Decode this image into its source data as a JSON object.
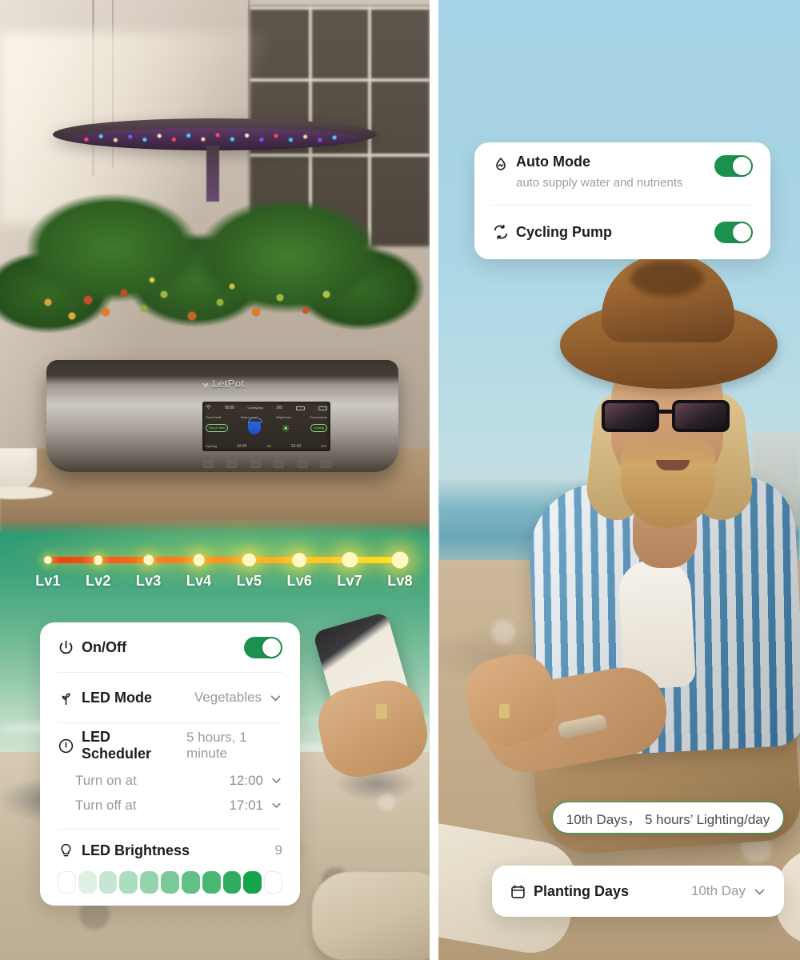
{
  "brand": {
    "name": "LetPot",
    "logo_icon": "leaf-icon"
  },
  "device_display": {
    "wifi_icon": "wifi-icon",
    "time": "00:00",
    "growby_label": "GrowbyDays",
    "growby_value": "8/5",
    "plant_mode_label": "Plant Mode",
    "plant_mode_value": "Veg & Herb",
    "water_level_label": "Water Level",
    "brightness_label": "Brightness",
    "pump_mode_label": "Pump Mode",
    "pump_mode_value": "Cycling",
    "lighting_label": "Lighting",
    "lighting_on": "10:00",
    "lighting_on_suffix": "ON",
    "lighting_off": "23:00",
    "lighting_off_suffix": "OFF"
  },
  "level_meter": {
    "labels": [
      "Lv1",
      "Lv2",
      "Lv3",
      "Lv4",
      "Lv5",
      "Lv6",
      "Lv7",
      "Lv8"
    ],
    "gradient_start": "#f03d12",
    "gradient_end": "#ffe01b"
  },
  "led_card": {
    "onoff": {
      "icon": "power-icon",
      "label": "On/Off",
      "toggle_on": true
    },
    "mode": {
      "icon": "sprout-icon",
      "label": "LED Mode",
      "value": "Vegetables",
      "chevron": "chevron-down-icon"
    },
    "scheduler": {
      "icon": "clock-icon",
      "label": "LED Scheduler",
      "value": "5 hours, 1 minute"
    },
    "turn_on": {
      "label": "Turn on at",
      "value": "12:00",
      "chevron": "chevron-down-icon"
    },
    "turn_off": {
      "label": "Turn off at",
      "value": "17:01",
      "chevron": "chevron-down-icon"
    },
    "brightness": {
      "icon": "bulb-icon",
      "label": "LED Brightness",
      "value": "9",
      "segments_total": 11,
      "segments_filled": 9
    }
  },
  "auto_card": {
    "auto_mode": {
      "icon": "water-drop-icon",
      "label": "Auto Mode",
      "description": "auto supply water and nutrients",
      "toggle_on": true
    },
    "cycling_pump": {
      "icon": "cycle-icon",
      "label": "Cycling Pump",
      "toggle_on": true
    }
  },
  "lighting_pill": {
    "text": "10th Days， 5 hours’ Lighting/day"
  },
  "planting_card": {
    "icon": "calendar-icon",
    "label": "Planting Days",
    "value": "10th Day",
    "chevron": "chevron-down-icon"
  },
  "colors": {
    "toggle_on": "#1b9150",
    "brightness_fill": "#17a24c",
    "pill_border": "#2f9e5f",
    "sky": "#a7d4e6",
    "sea_green": "#2f9b74"
  }
}
